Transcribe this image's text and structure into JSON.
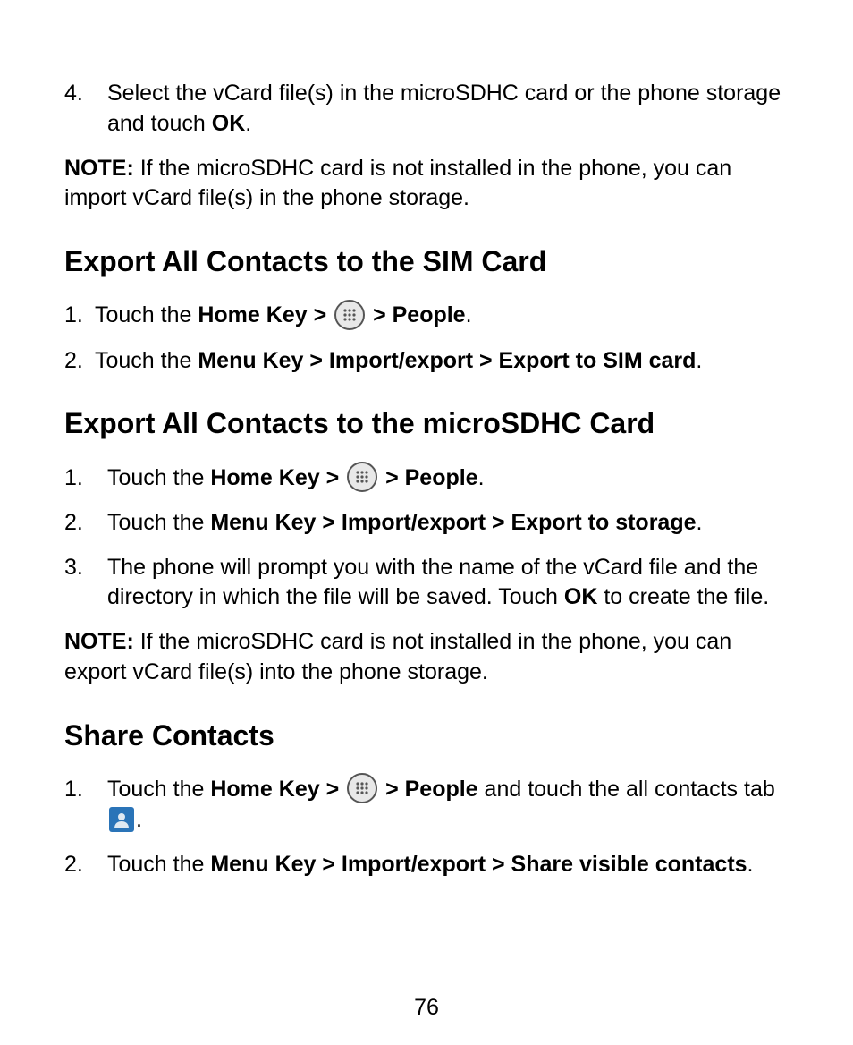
{
  "page_number": "76",
  "intro_list": [
    {
      "n": "4.",
      "pre": "Select the vCard file(s) in the microSDHC card or the phone storage and touch ",
      "bold": "OK",
      "post": "."
    }
  ],
  "intro_note": {
    "label": "NOTE:",
    "text": " If the microSDHC card is not installed in the phone, you can import vCard file(s) in the phone storage."
  },
  "section1": {
    "heading": "Export All Contacts to the SIM Card",
    "items": [
      {
        "n": "1.",
        "t1": "Touch the ",
        "b1": "Home Key > ",
        "b2": " > People",
        "t2": "."
      },
      {
        "n": "2.",
        "t1": "Touch the ",
        "b1": "Menu Key > Import/export > Export to SIM card",
        "t2": "."
      }
    ]
  },
  "section2": {
    "heading": "Export All Contacts to the microSDHC Card",
    "items": [
      {
        "n": "1.",
        "t1": "Touch the ",
        "b1": "Home Key > ",
        "b2": " > People",
        "t2": "."
      },
      {
        "n": "2.",
        "t1": "Touch the ",
        "b1": "Menu Key > Import/export > Export to storage",
        "t2": "."
      },
      {
        "n": "3.",
        "t1": "The phone will prompt you with the name of the vCard file and the directory in which the file will be saved. Touch ",
        "b1": "OK",
        "t2": " to create the file."
      }
    ],
    "note": {
      "label": "NOTE:",
      "text": " If the microSDHC card is not installed in the phone, you can export vCard file(s) into the phone storage."
    }
  },
  "section3": {
    "heading": "Share Contacts",
    "items": [
      {
        "n": "1.",
        "t1": "Touch the ",
        "b1": "Home Key > ",
        "b2": " > People",
        "t2": " and touch the all contacts tab ",
        "t3": "."
      },
      {
        "n": "2.",
        "t1": "Touch the ",
        "b1": "Menu Key > Import/export > Share visible contacts",
        "t2": "."
      }
    ]
  }
}
